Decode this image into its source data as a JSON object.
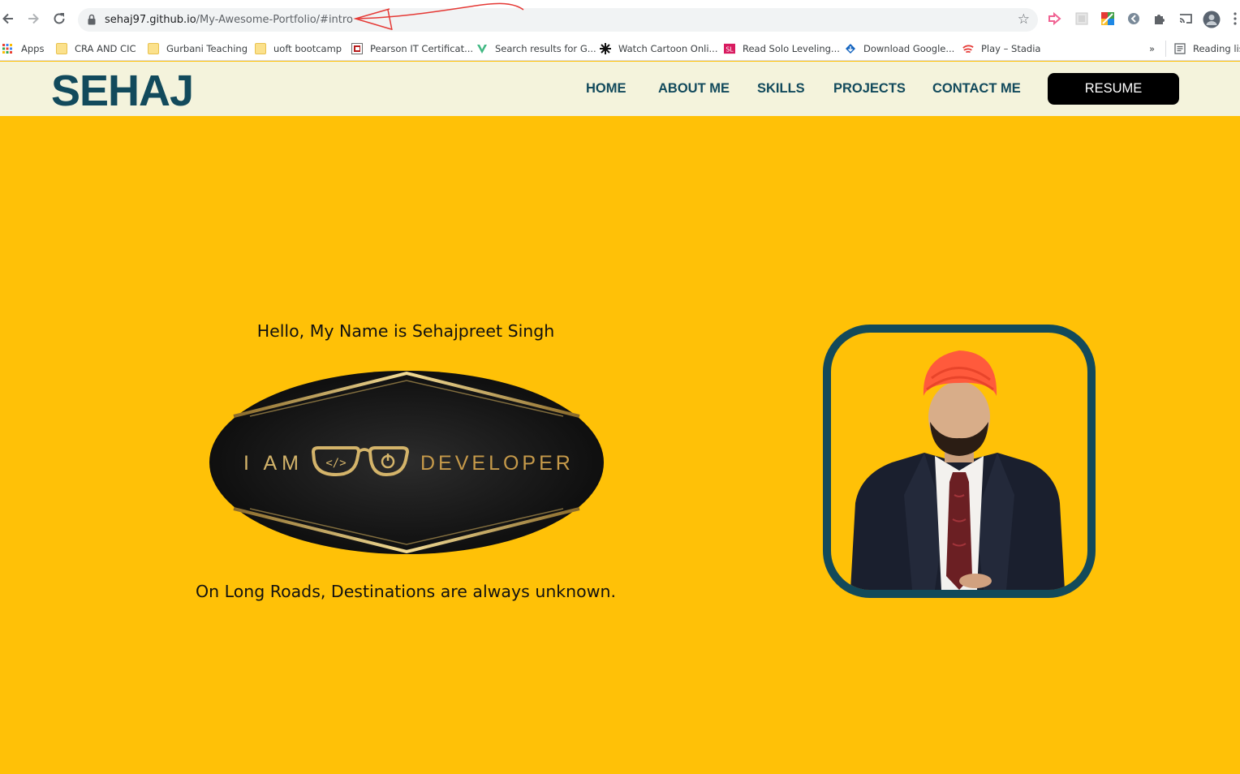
{
  "browser": {
    "url_host": "sehaj97.github.io",
    "url_path": "/My-Awesome-Portfolio/#intro",
    "bookmarks": [
      {
        "label": "Apps",
        "icon": "apps-grid-icon"
      },
      {
        "label": "CRA AND CIC",
        "icon": "folder-icon"
      },
      {
        "label": "Gurbani Teaching",
        "icon": "folder-icon"
      },
      {
        "label": "uoft bootcamp",
        "icon": "folder-icon"
      },
      {
        "label": "Pearson IT Certificat...",
        "icon": "pearson-icon"
      },
      {
        "label": "Search results for G...",
        "icon": "vuetify-icon"
      },
      {
        "label": "Watch Cartoon Onli...",
        "icon": "cartoon-icon"
      },
      {
        "label": "Read Solo Leveling...",
        "icon": "sl-icon"
      },
      {
        "label": "Download Google...",
        "icon": "download-icon"
      },
      {
        "label": "Play – Stadia",
        "icon": "stadia-icon"
      }
    ],
    "overflow_label": "»",
    "reading_list_label": "Reading lis"
  },
  "site": {
    "logo": "SEHAJ",
    "nav": [
      "HOME",
      "ABOUT ME",
      "SKILLS",
      "PROJECTS",
      "CONTACT ME"
    ],
    "resume_label": "RESUME"
  },
  "intro": {
    "hello": "Hello, My Name is Sehajpreet Singh",
    "badge_left": "I AM",
    "badge_right": "DEVELOPER",
    "tagline": "On Long Roads, Destinations are always unknown."
  },
  "colors": {
    "page_bg": "#ffc107",
    "header_bg": "#f4f3dc",
    "brand": "#124a5c",
    "gold": "#d4b46a"
  }
}
